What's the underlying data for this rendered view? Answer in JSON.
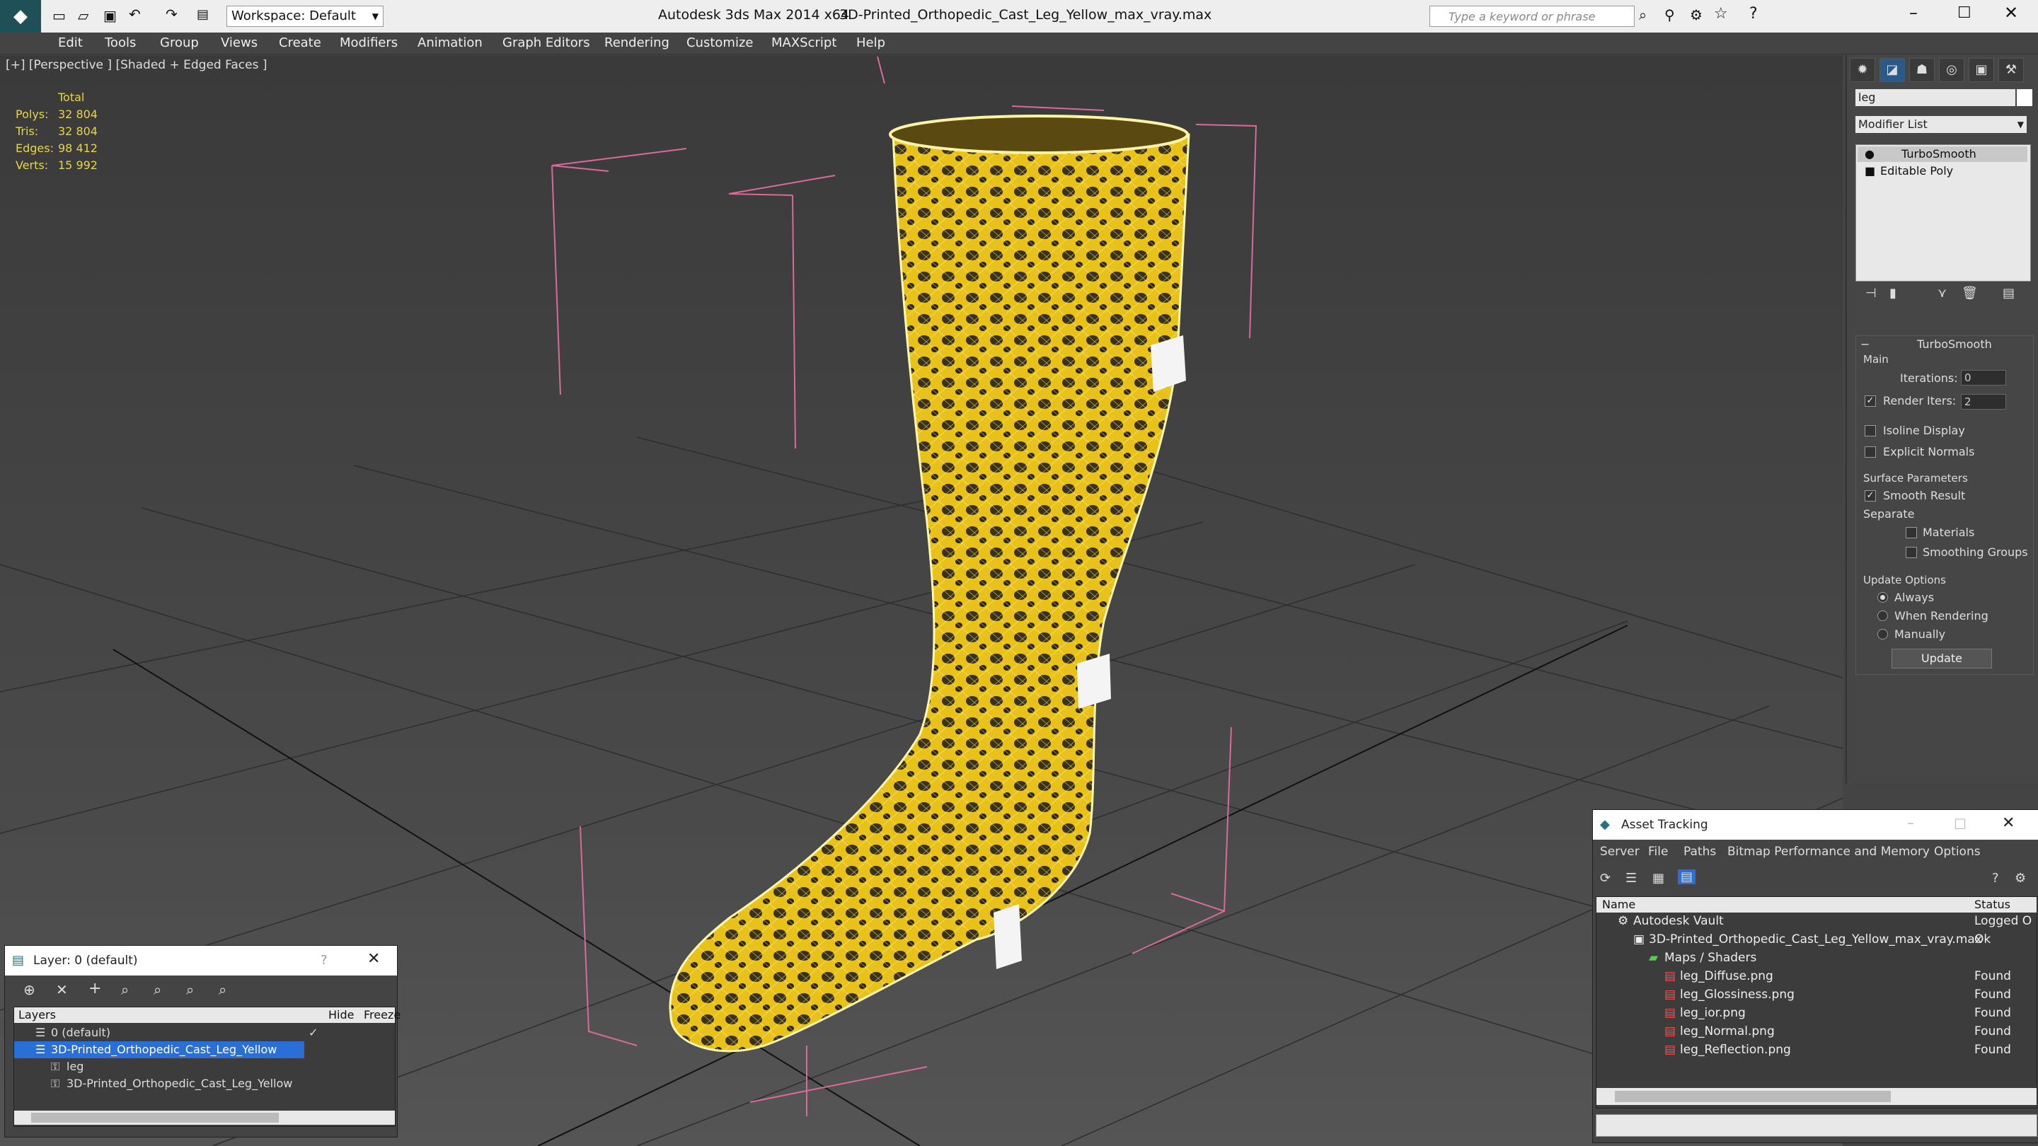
{
  "app": {
    "title": "Autodesk 3ds Max  2014 x64",
    "file": "3D-Printed_Orthopedic_Cast_Leg_Yellow_max_vray.max",
    "workspace": "Workspace: Default",
    "search_placeholder": "Type a keyword or phrase"
  },
  "menu": [
    "Edit",
    "Tools",
    "Group",
    "Views",
    "Create",
    "Modifiers",
    "Animation",
    "Graph Editors",
    "Rendering",
    "Customize",
    "MAXScript",
    "Help"
  ],
  "viewport": {
    "label": "[+] [Perspective ] [Shaded + Edged Faces ]",
    "stats_header": "Total",
    "stats": [
      {
        "name": "Polys:",
        "value": "32 804"
      },
      {
        "name": "Tris:",
        "value": "32 804"
      },
      {
        "name": "Edges:",
        "value": "98 412"
      },
      {
        "name": "Verts:",
        "value": "15 992"
      }
    ]
  },
  "command_panel": {
    "object_name": "leg",
    "modifier_list": "Modifier List",
    "stack": [
      "TurboSmooth",
      "Editable Poly"
    ],
    "rollout_title": "TurboSmooth",
    "main_label": "Main",
    "iterations_label": "Iterations:",
    "iterations_value": "0",
    "render_iters_label": "Render Iters:",
    "render_iters_value": "2",
    "isoline": "Isoline Display",
    "explicit_normals": "Explicit Normals",
    "surface_params": "Surface Parameters",
    "smooth_result": "Smooth Result",
    "separate": "Separate",
    "materials": "Materials",
    "smoothing_groups": "Smoothing Groups",
    "update_options": "Update Options",
    "always": "Always",
    "when_rendering": "When Rendering",
    "manually": "Manually",
    "update_button": "Update"
  },
  "layer_window": {
    "title": "Layer: 0 (default)",
    "help": "?",
    "columns": [
      "Layers",
      "Hide",
      "Freeze"
    ],
    "rows": [
      {
        "name": "0 (default)"
      },
      {
        "name": "3D-Printed_Orthopedic_Cast_Leg_Yellow"
      },
      {
        "name": "leg"
      },
      {
        "name": "3D-Printed_Orthopedic_Cast_Leg_Yellow"
      }
    ]
  },
  "asset_window": {
    "title": "Asset Tracking",
    "menu": [
      "Server",
      "File",
      "Paths",
      "Bitmap Performance and Memory",
      "Options"
    ],
    "columns": [
      "Name",
      "Status"
    ],
    "rows": [
      {
        "name": "Autodesk Vault",
        "status": "Logged O"
      },
      {
        "name": "3D-Printed_Orthopedic_Cast_Leg_Yellow_max_vray.max",
        "status": "Ok"
      },
      {
        "name": "Maps / Shaders",
        "status": ""
      },
      {
        "name": "leg_Diffuse.png",
        "status": "Found"
      },
      {
        "name": "leg_Glossiness.png",
        "status": "Found"
      },
      {
        "name": "leg_ior.png",
        "status": "Found"
      },
      {
        "name": "leg_Normal.png",
        "status": "Found"
      },
      {
        "name": "leg_Reflection.png",
        "status": "Found"
      }
    ]
  },
  "colors": {
    "model": "#e8c21a",
    "selection": "#2a6fd6",
    "stats": "#e8d44a"
  }
}
